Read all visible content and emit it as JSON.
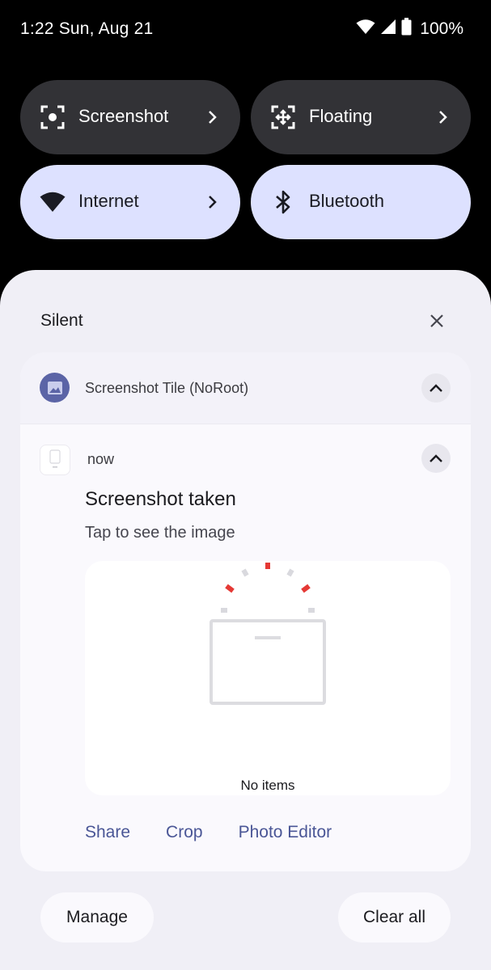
{
  "status_bar": {
    "time_date": "1:22 Sun, Aug 21",
    "battery": "100%",
    "icons": [
      "wifi-icon",
      "cellular-signal-icon",
      "battery-icon"
    ]
  },
  "quick_tiles": [
    {
      "label": "Screenshot",
      "icon": "screenshot-icon",
      "state": "off",
      "has_chevron": true
    },
    {
      "label": "Floating",
      "icon": "floating-icon",
      "state": "off",
      "has_chevron": true
    },
    {
      "label": "Internet",
      "icon": "wifi-icon",
      "state": "on",
      "has_chevron": true
    },
    {
      "label": "Bluetooth",
      "icon": "bluetooth-icon",
      "state": "on",
      "has_chevron": false
    }
  ],
  "notifications": {
    "section_label": "Silent",
    "app_name": "Screenshot Tile (NoRoot)",
    "time": "now",
    "title": "Screenshot taken",
    "text": "Tap to see the image",
    "preview_empty_text": "No items",
    "actions": [
      "Share",
      "Crop",
      "Photo Editor"
    ]
  },
  "footer": {
    "manage_label": "Manage",
    "clear_all_label": "Clear all"
  },
  "colors": {
    "background": "#000000",
    "tile_dark": "#323236",
    "tile_light": "#dde1ff",
    "sheet": "#f0eff6",
    "accent_text": "#4a5696",
    "app_icon": "#5b64a6",
    "loader_red": "#e53935"
  }
}
